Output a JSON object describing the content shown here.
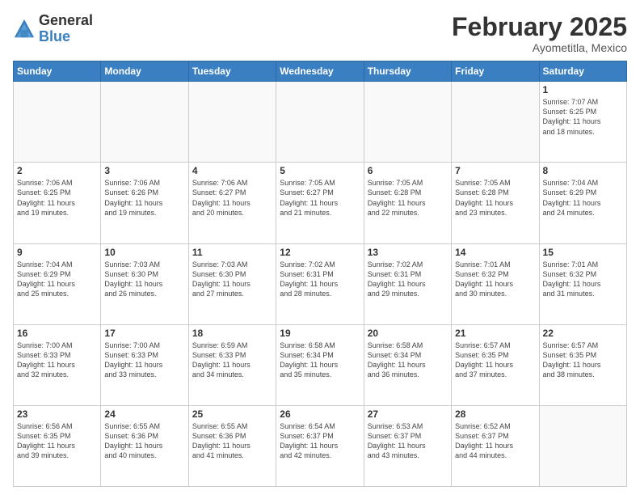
{
  "logo": {
    "general": "General",
    "blue": "Blue"
  },
  "header": {
    "month": "February 2025",
    "location": "Ayometitla, Mexico"
  },
  "weekdays": [
    "Sunday",
    "Monday",
    "Tuesday",
    "Wednesday",
    "Thursday",
    "Friday",
    "Saturday"
  ],
  "weeks": [
    [
      {
        "day": "",
        "info": ""
      },
      {
        "day": "",
        "info": ""
      },
      {
        "day": "",
        "info": ""
      },
      {
        "day": "",
        "info": ""
      },
      {
        "day": "",
        "info": ""
      },
      {
        "day": "",
        "info": ""
      },
      {
        "day": "1",
        "info": "Sunrise: 7:07 AM\nSunset: 6:25 PM\nDaylight: 11 hours\nand 18 minutes."
      }
    ],
    [
      {
        "day": "2",
        "info": "Sunrise: 7:06 AM\nSunset: 6:25 PM\nDaylight: 11 hours\nand 19 minutes."
      },
      {
        "day": "3",
        "info": "Sunrise: 7:06 AM\nSunset: 6:26 PM\nDaylight: 11 hours\nand 19 minutes."
      },
      {
        "day": "4",
        "info": "Sunrise: 7:06 AM\nSunset: 6:27 PM\nDaylight: 11 hours\nand 20 minutes."
      },
      {
        "day": "5",
        "info": "Sunrise: 7:05 AM\nSunset: 6:27 PM\nDaylight: 11 hours\nand 21 minutes."
      },
      {
        "day": "6",
        "info": "Sunrise: 7:05 AM\nSunset: 6:28 PM\nDaylight: 11 hours\nand 22 minutes."
      },
      {
        "day": "7",
        "info": "Sunrise: 7:05 AM\nSunset: 6:28 PM\nDaylight: 11 hours\nand 23 minutes."
      },
      {
        "day": "8",
        "info": "Sunrise: 7:04 AM\nSunset: 6:29 PM\nDaylight: 11 hours\nand 24 minutes."
      }
    ],
    [
      {
        "day": "9",
        "info": "Sunrise: 7:04 AM\nSunset: 6:29 PM\nDaylight: 11 hours\nand 25 minutes."
      },
      {
        "day": "10",
        "info": "Sunrise: 7:03 AM\nSunset: 6:30 PM\nDaylight: 11 hours\nand 26 minutes."
      },
      {
        "day": "11",
        "info": "Sunrise: 7:03 AM\nSunset: 6:30 PM\nDaylight: 11 hours\nand 27 minutes."
      },
      {
        "day": "12",
        "info": "Sunrise: 7:02 AM\nSunset: 6:31 PM\nDaylight: 11 hours\nand 28 minutes."
      },
      {
        "day": "13",
        "info": "Sunrise: 7:02 AM\nSunset: 6:31 PM\nDaylight: 11 hours\nand 29 minutes."
      },
      {
        "day": "14",
        "info": "Sunrise: 7:01 AM\nSunset: 6:32 PM\nDaylight: 11 hours\nand 30 minutes."
      },
      {
        "day": "15",
        "info": "Sunrise: 7:01 AM\nSunset: 6:32 PM\nDaylight: 11 hours\nand 31 minutes."
      }
    ],
    [
      {
        "day": "16",
        "info": "Sunrise: 7:00 AM\nSunset: 6:33 PM\nDaylight: 11 hours\nand 32 minutes."
      },
      {
        "day": "17",
        "info": "Sunrise: 7:00 AM\nSunset: 6:33 PM\nDaylight: 11 hours\nand 33 minutes."
      },
      {
        "day": "18",
        "info": "Sunrise: 6:59 AM\nSunset: 6:33 PM\nDaylight: 11 hours\nand 34 minutes."
      },
      {
        "day": "19",
        "info": "Sunrise: 6:58 AM\nSunset: 6:34 PM\nDaylight: 11 hours\nand 35 minutes."
      },
      {
        "day": "20",
        "info": "Sunrise: 6:58 AM\nSunset: 6:34 PM\nDaylight: 11 hours\nand 36 minutes."
      },
      {
        "day": "21",
        "info": "Sunrise: 6:57 AM\nSunset: 6:35 PM\nDaylight: 11 hours\nand 37 minutes."
      },
      {
        "day": "22",
        "info": "Sunrise: 6:57 AM\nSunset: 6:35 PM\nDaylight: 11 hours\nand 38 minutes."
      }
    ],
    [
      {
        "day": "23",
        "info": "Sunrise: 6:56 AM\nSunset: 6:35 PM\nDaylight: 11 hours\nand 39 minutes."
      },
      {
        "day": "24",
        "info": "Sunrise: 6:55 AM\nSunset: 6:36 PM\nDaylight: 11 hours\nand 40 minutes."
      },
      {
        "day": "25",
        "info": "Sunrise: 6:55 AM\nSunset: 6:36 PM\nDaylight: 11 hours\nand 41 minutes."
      },
      {
        "day": "26",
        "info": "Sunrise: 6:54 AM\nSunset: 6:37 PM\nDaylight: 11 hours\nand 42 minutes."
      },
      {
        "day": "27",
        "info": "Sunrise: 6:53 AM\nSunset: 6:37 PM\nDaylight: 11 hours\nand 43 minutes."
      },
      {
        "day": "28",
        "info": "Sunrise: 6:52 AM\nSunset: 6:37 PM\nDaylight: 11 hours\nand 44 minutes."
      },
      {
        "day": "",
        "info": ""
      }
    ]
  ]
}
